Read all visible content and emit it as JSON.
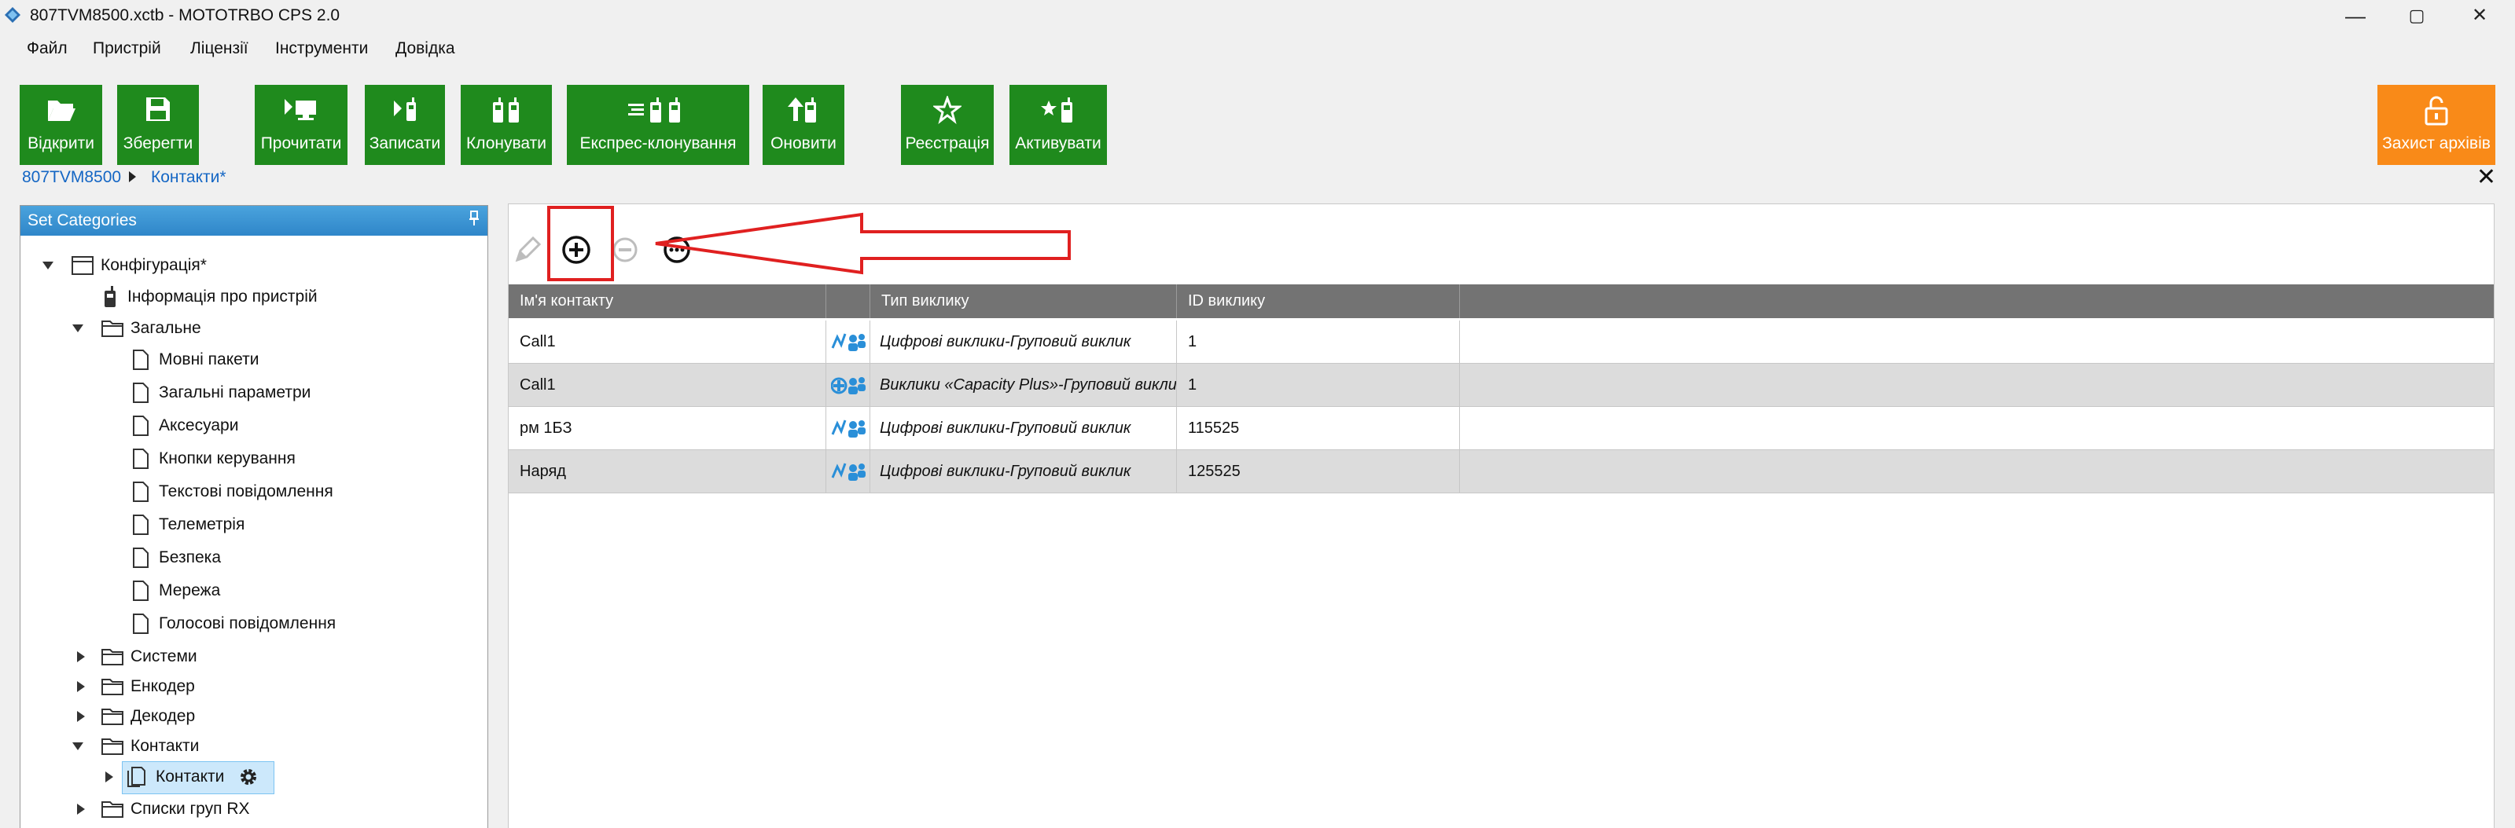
{
  "window": {
    "title": "807TVM8500.xctb - MOTOTRBO CPS 2.0",
    "controls": [
      "—",
      "▢",
      "✕"
    ]
  },
  "menu": [
    "Файл",
    "Пристрій",
    "Ліцензії",
    "Інструменти",
    "Довідка"
  ],
  "toolbar": {
    "open": "Відкрити",
    "save": "Зберегти",
    "read": "Прочитати",
    "write": "Записати",
    "clone": "Клонувати",
    "express_clone": "Експрес-клонування",
    "update": "Оновити",
    "register": "Реєстрація",
    "activate": "Активувати",
    "archive_protect": "Захист архівів",
    "colors": {
      "green": "#1f8a1d",
      "orange": "#f98a18"
    }
  },
  "breadcrumb": {
    "root": "807TVM8500",
    "current": "Контакти*"
  },
  "left_panel": {
    "title": "Set Categories",
    "tree": {
      "config": "Конфігурація*",
      "device_info": "Інформація про пристрій",
      "general": "Загальне",
      "general_items": [
        "Мовні пакети",
        "Загальні параметри",
        "Аксесуари",
        "Кнопки керування",
        "Текстові повідомлення",
        "Телеметрія",
        "Безпека",
        "Мережа",
        "Голосові повідомлення"
      ],
      "systems": "Системи",
      "encoder": "Енкодер",
      "decoder": "Декодер",
      "contacts_folder": "Контакти",
      "contacts_node": "Контакти",
      "rx_groups": "Списки груп RX"
    }
  },
  "grid": {
    "columns": [
      "Ім'я контакту",
      "",
      "Тип виклику",
      "ID виклику"
    ],
    "rows": [
      {
        "name": "Call1",
        "type": "Цифрові виклики-Груповий виклик",
        "id": "1",
        "icon": "digital-group-call-icon"
      },
      {
        "name": "Call1",
        "type": "Виклики «Capacity Plus»-Груповий виклик",
        "id": "1",
        "icon": "capacity-plus-group-call-icon"
      },
      {
        "name": "рм 1БЗ",
        "type": "Цифрові виклики-Груповий виклик",
        "id": "115525",
        "icon": "digital-group-call-icon"
      },
      {
        "name": "Наряд",
        "type": "Цифрові виклики-Груповий виклик",
        "id": "125525",
        "icon": "digital-group-call-icon"
      }
    ]
  },
  "annotation": {
    "color": "#e02020"
  }
}
